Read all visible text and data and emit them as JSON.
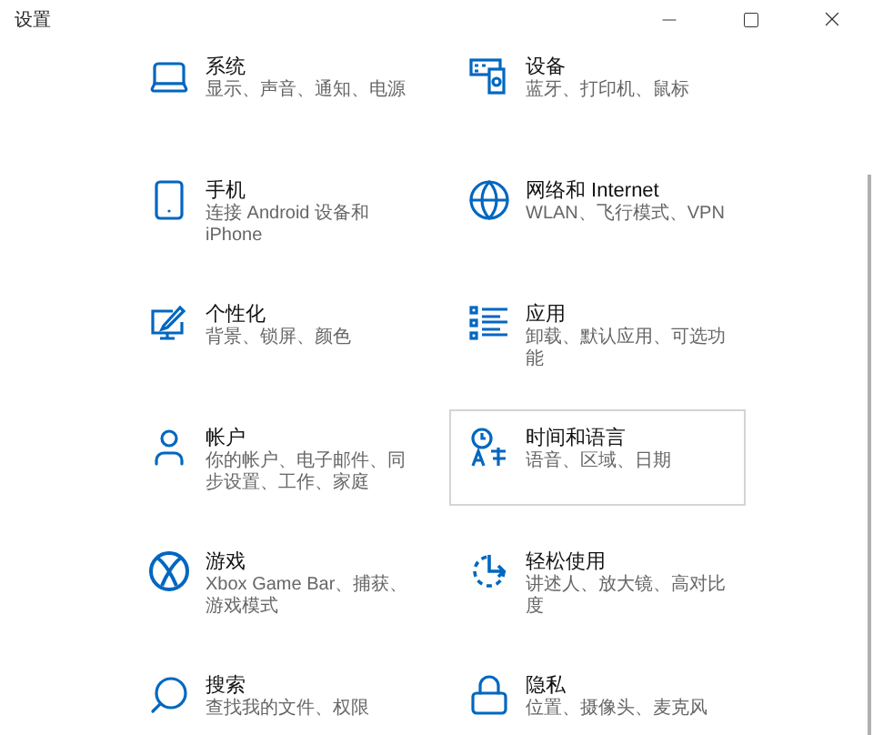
{
  "window": {
    "title": "设置"
  },
  "tiles": [
    {
      "title": "系统",
      "subtitle": "显示、声音、通知、电源",
      "hovered": false
    },
    {
      "title": "设备",
      "subtitle": "蓝牙、打印机、鼠标",
      "hovered": false
    },
    {
      "title": "手机",
      "subtitle": "连接 Android 设备和 iPhone",
      "hovered": false
    },
    {
      "title": "网络和 Internet",
      "subtitle": "WLAN、飞行模式、VPN",
      "hovered": false
    },
    {
      "title": "个性化",
      "subtitle": "背景、锁屏、颜色",
      "hovered": false
    },
    {
      "title": "应用",
      "subtitle": "卸载、默认应用、可选功能",
      "hovered": false
    },
    {
      "title": "帐户",
      "subtitle": "你的帐户、电子邮件、同步设置、工作、家庭",
      "hovered": false
    },
    {
      "title": "时间和语言",
      "subtitle": "语音、区域、日期",
      "hovered": true
    },
    {
      "title": "游戏",
      "subtitle": "Xbox Game Bar、捕获、游戏模式",
      "hovered": false
    },
    {
      "title": "轻松使用",
      "subtitle": "讲述人、放大镜、高对比度",
      "hovered": false
    },
    {
      "title": "搜索",
      "subtitle": "查找我的文件、权限",
      "hovered": false
    },
    {
      "title": "隐私",
      "subtitle": "位置、摄像头、麦克风",
      "hovered": false
    }
  ]
}
